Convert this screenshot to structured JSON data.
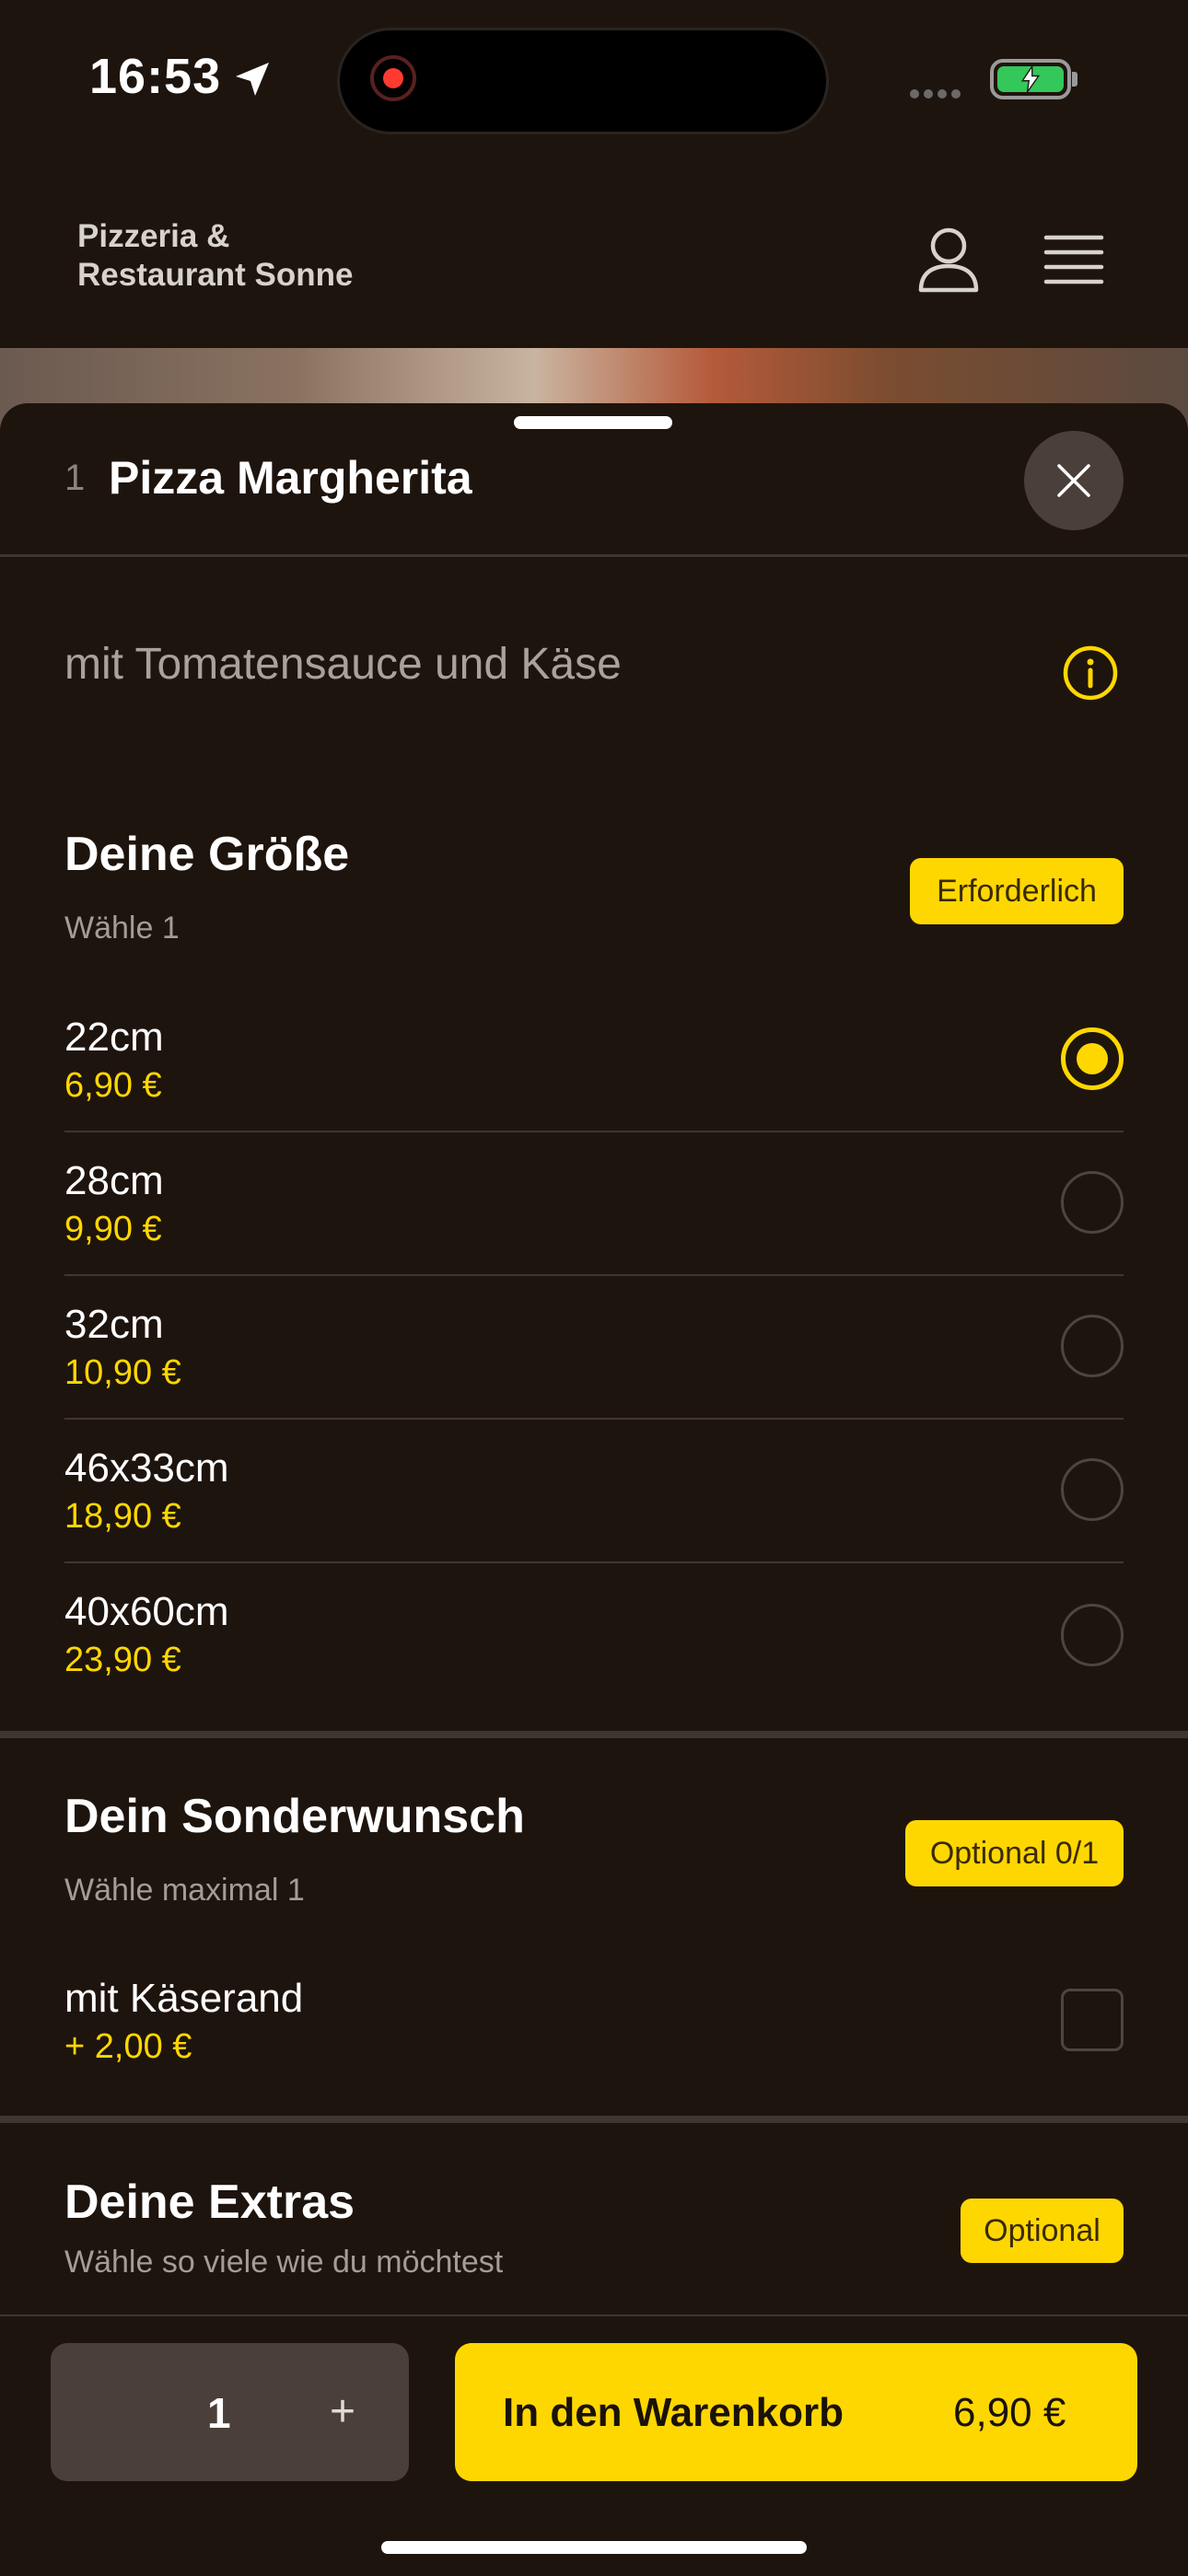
{
  "status_bar": {
    "time": "16:53"
  },
  "header": {
    "brand_line1": "Pizzeria &",
    "brand_line2": "Restaurant Sonne"
  },
  "product": {
    "quantity_prefix": "1",
    "title": "Pizza Margherita",
    "description": "mit Tomatensauce und Käse"
  },
  "size_section": {
    "title": "Deine Größe",
    "subtitle": "Wähle 1",
    "badge": "Erforderlich",
    "options": [
      {
        "label": "22cm",
        "price": "6,90 €",
        "selected": true
      },
      {
        "label": "28cm",
        "price": "9,90 €",
        "selected": false
      },
      {
        "label": "32cm",
        "price": "10,90 €",
        "selected": false
      },
      {
        "label": "46x33cm",
        "price": "18,90 €",
        "selected": false
      },
      {
        "label": "40x60cm",
        "price": "23,90 €",
        "selected": false
      }
    ]
  },
  "special_section": {
    "title": "Dein Sonderwunsch",
    "subtitle": "Wähle maximal 1",
    "badge": "Optional 0/1",
    "options": [
      {
        "label": "mit Käserand",
        "price": "+ 2,00 €",
        "checked": false
      }
    ]
  },
  "extras_section": {
    "title": "Deine Extras",
    "subtitle": "Wähle so viele wie du möchtest",
    "badge": "Optional"
  },
  "bottom_bar": {
    "quantity": "1",
    "plus": "+",
    "cart_label": "In den Warenkorb",
    "cart_price": "6,90 €"
  },
  "colors": {
    "accent": "#ffd700",
    "background": "#1e140e",
    "surface": "#4a3f39"
  },
  "icons": [
    "location-arrow-icon",
    "record-icon",
    "battery-charging-icon",
    "user-icon",
    "menu-icon",
    "close-icon",
    "info-icon",
    "plus-icon"
  ]
}
